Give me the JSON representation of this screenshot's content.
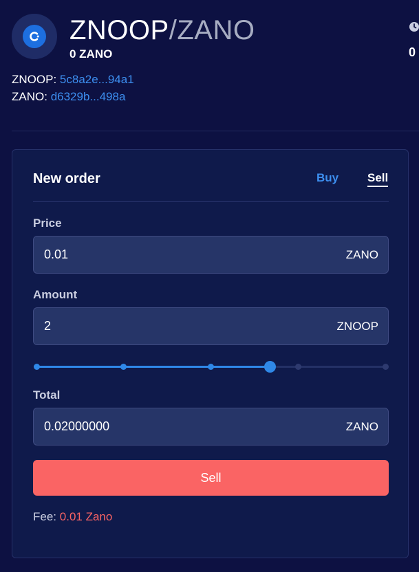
{
  "pair": {
    "base": "ZNOOP",
    "separator": "/",
    "quote": "ZANO",
    "balance": "0 ZANO",
    "right_value": "0",
    "logo_icon": "zano-c-logo-icon"
  },
  "asset_ids": {
    "base_label": "ZNOOP:",
    "base_id": "5c8a2e...94a1",
    "quote_label": "ZANO:",
    "quote_id": "d6329b...498a"
  },
  "order": {
    "title": "New order",
    "tabs": {
      "buy": "Buy",
      "sell": "Sell",
      "active": "sell"
    },
    "price": {
      "label": "Price",
      "value": "0.01",
      "unit": "ZANO"
    },
    "amount": {
      "label": "Amount",
      "value": "2",
      "unit": "ZNOOP"
    },
    "slider": {
      "level_percent": 67,
      "stops_percent": [
        0,
        25,
        50,
        75,
        100
      ]
    },
    "total": {
      "label": "Total",
      "value": "0.02000000",
      "unit": "ZANO"
    },
    "submit_label": "Sell",
    "fee_label": "Fee:",
    "fee_value": "0.01 Zano"
  },
  "colors": {
    "background": "#0d1142",
    "card": "#0f1a4b",
    "accent_blue": "#3d8ff0",
    "sell_red": "#fa6464"
  }
}
